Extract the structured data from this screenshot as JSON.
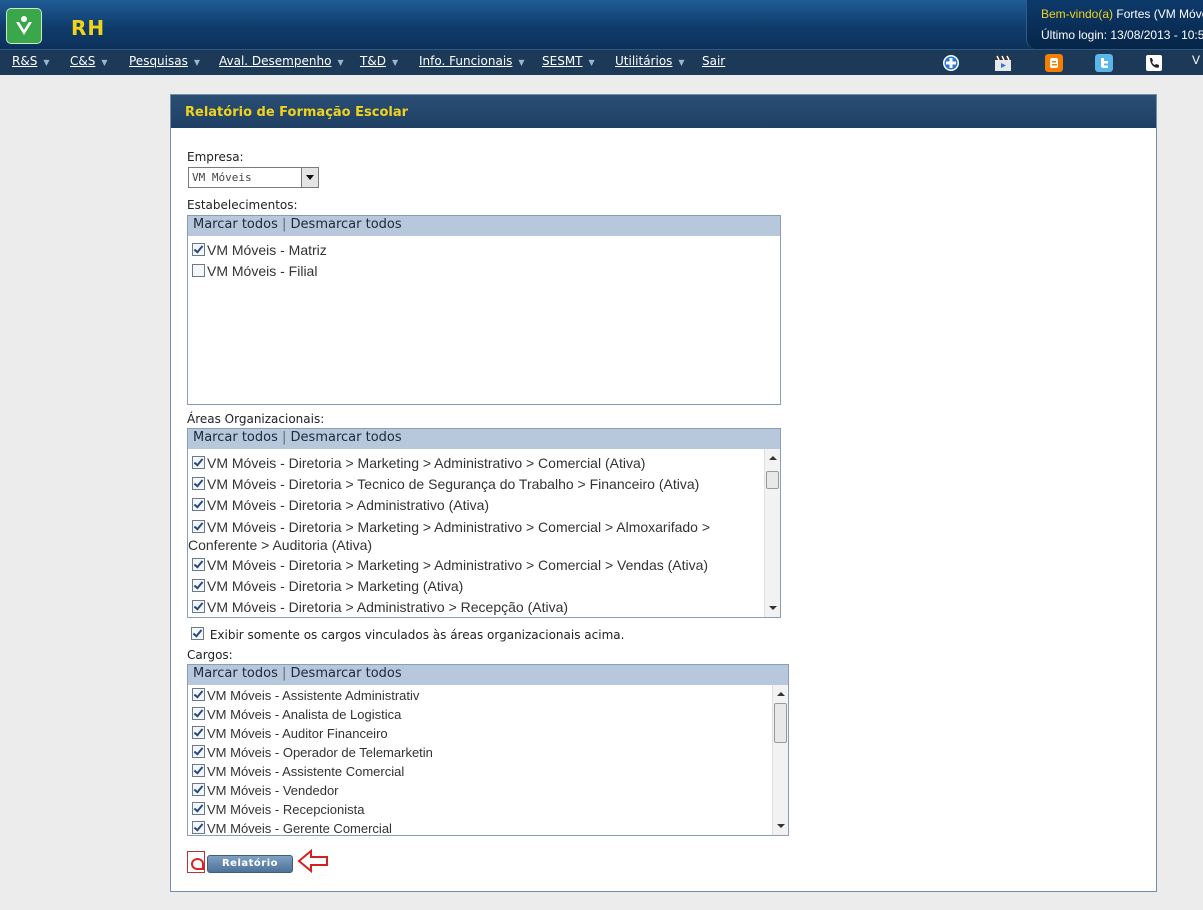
{
  "header": {
    "app_title": "RH",
    "welcome_label": "Bem-vindo(a)",
    "welcome_user": "Fortes (VM Móve",
    "last_login": "Último login: 13/08/2013 - 10:5"
  },
  "menu": {
    "items": [
      {
        "label": "R&S"
      },
      {
        "label": "C&S"
      },
      {
        "label": "Pesquisas"
      },
      {
        "label": "Aval. Desempenho"
      },
      {
        "label": "T&D"
      },
      {
        "label": "Info. Funcionais"
      },
      {
        "label": "SESMT"
      },
      {
        "label": "Utilitários"
      },
      {
        "label": "Sair"
      }
    ],
    "trailing_text": "V"
  },
  "panel": {
    "title": "Relatório de Formação Escolar",
    "empresa_label": "Empresa:",
    "empresa_value": "VM Móveis",
    "estab_label": "Estabelecimentos:",
    "areas_label": "Áreas Organizacionais:",
    "cargos_label": "Cargos:",
    "marcar": "Marcar todos",
    "sep": "|",
    "desmarcar": "Desmarcar todos",
    "exibir_label": "Exibir somente os cargos vinculados às áreas organizacionais acima.",
    "report_button": "Relatório"
  },
  "estabelecimentos": [
    {
      "label": "VM Móveis - Matriz",
      "checked": true
    },
    {
      "label": "VM Móveis - Filial",
      "checked": false
    }
  ],
  "areas": [
    {
      "label": "VM Móveis - Diretoria > Marketing > Administrativo > Comercial (Ativa)",
      "checked": true
    },
    {
      "label": "VM Móveis - Diretoria > Tecnico de Segurança do Trabalho > Financeiro (Ativa)",
      "checked": true
    },
    {
      "label": "VM Móveis - Diretoria > Administrativo (Ativa)",
      "checked": true
    },
    {
      "label": "VM Móveis - Diretoria > Marketing > Administrativo > Comercial > Almoxarifado > Conferente > Auditoria (Ativa)",
      "checked": true
    },
    {
      "label": "VM Móveis - Diretoria > Marketing > Administrativo > Comercial > Vendas (Ativa)",
      "checked": true
    },
    {
      "label": "VM Móveis - Diretoria > Marketing (Ativa)",
      "checked": true
    },
    {
      "label": "VM Móveis - Diretoria > Administrativo > Recepção (Ativa)",
      "checked": true
    }
  ],
  "cargos": [
    {
      "label": "VM Móveis - Assistente Administrativ",
      "checked": true
    },
    {
      "label": "VM Móveis - Analista de Logistica",
      "checked": true
    },
    {
      "label": "VM Móveis - Auditor Financeiro",
      "checked": true
    },
    {
      "label": "VM Móveis - Operador de Telemarketin",
      "checked": true
    },
    {
      "label": "VM Móveis - Assistente Comercial",
      "checked": true
    },
    {
      "label": "VM Móveis - Vendedor",
      "checked": true
    },
    {
      "label": "VM Móveis - Recepcionista",
      "checked": true
    },
    {
      "label": "VM Móveis - Gerente Comercial",
      "checked": true
    }
  ],
  "exibir_checked": true,
  "colors": {
    "header_blue": "#0f3a68",
    "menu_bg": "#1c3a57",
    "title_yellow": "#f2d31c",
    "list_header": "#b7c7dc",
    "arrow_red": "#d62020"
  }
}
